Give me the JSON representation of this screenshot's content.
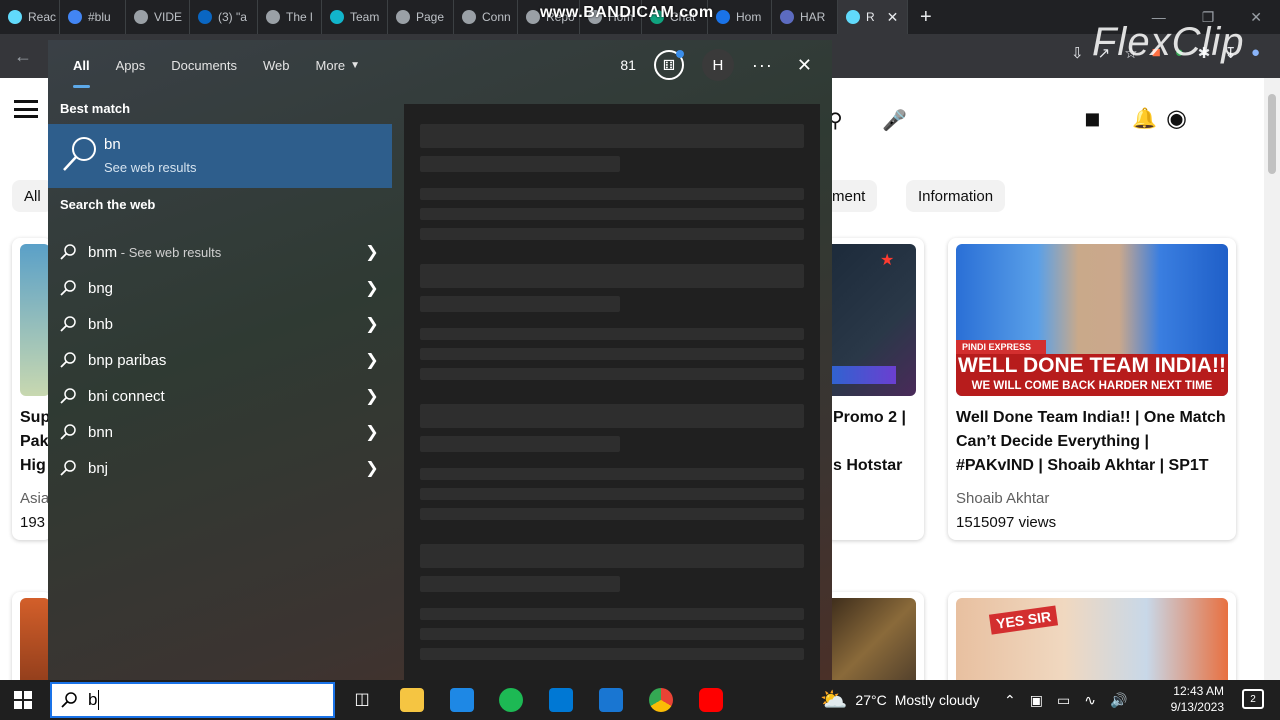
{
  "browser": {
    "tabs": [
      {
        "label": "Reac",
        "color": "#61dafb"
      },
      {
        "label": "#blu",
        "color": "#4285f4"
      },
      {
        "label": "VIDE",
        "color": "#9aa0a6"
      },
      {
        "label": "(3) \"a",
        "color": "#0a66c2"
      },
      {
        "label": "The l",
        "color": "#9aa0a6"
      },
      {
        "label": "Team",
        "color": "#12b5cb"
      },
      {
        "label": "Page",
        "color": "#9aa0a6"
      },
      {
        "label": "Conn",
        "color": "#9aa0a6"
      },
      {
        "label": "Repo",
        "color": "#9aa0a6"
      },
      {
        "label": "Hom",
        "color": "#9aa0a6"
      },
      {
        "label": "Chat",
        "color": "#10a37f"
      },
      {
        "label": "Hom",
        "color": "#1a73e8"
      },
      {
        "label": "HAR",
        "color": "#5c6bc0"
      },
      {
        "label": "R",
        "color": "#61dafb",
        "active": true
      }
    ],
    "watermark_recorder": "www.BANDICAM.com",
    "watermark_editor": "FlexClip"
  },
  "page_behind": {
    "chips": [
      "All",
      "ment",
      "Information"
    ],
    "cards": [
      {
        "title_lines": [
          "Sup",
          "Pak",
          "Hig"
        ],
        "channel": "Asia",
        "views": "193"
      },
      {
        "title_lines": [
          "Promo 2 |",
          "",
          "s Hotstar"
        ],
        "channel": "",
        "views": ""
      },
      {
        "title_lines": [
          "Well Done Team India!! | One Match",
          "Can’t Decide Everything |",
          "#PAKvIND | Shoaib Akhtar | SP1T"
        ],
        "channel": "Shoaib Akhtar",
        "views": "1515097 views",
        "thumb_text_1": "WELL DONE TEAM INDIA!!",
        "thumb_text_2": "WE WILL COME BACK HARDER NEXT TIME",
        "thumb_badge": "PINDI EXPRESS"
      }
    ],
    "bottom_thumb_badge": "YES SIR"
  },
  "search": {
    "tabs": [
      "All",
      "Apps",
      "Documents",
      "Web",
      "More"
    ],
    "active_tab": "All",
    "points": "81",
    "avatar_initial": "H",
    "more_glyph": "···",
    "close_glyph": "✕",
    "best_match_header": "Best match",
    "best_match": {
      "title": "bn",
      "subtitle": "See web results"
    },
    "web_header": "Search the web",
    "suggestions": [
      {
        "text": "bnm",
        "suffix": " - See web results"
      },
      {
        "text": "bng",
        "suffix": ""
      },
      {
        "text": "bnb",
        "suffix": ""
      },
      {
        "text": "bnp paribas",
        "suffix": ""
      },
      {
        "text": "bni connect",
        "suffix": ""
      },
      {
        "text": "bnn",
        "suffix": ""
      },
      {
        "text": "bnj",
        "suffix": ""
      }
    ]
  },
  "taskbar": {
    "search_value": "b",
    "weather_temp": "27°C",
    "weather_desc": "Mostly cloudy",
    "time": "12:43 AM",
    "date": "9/13/2023",
    "notification_count": "2"
  }
}
